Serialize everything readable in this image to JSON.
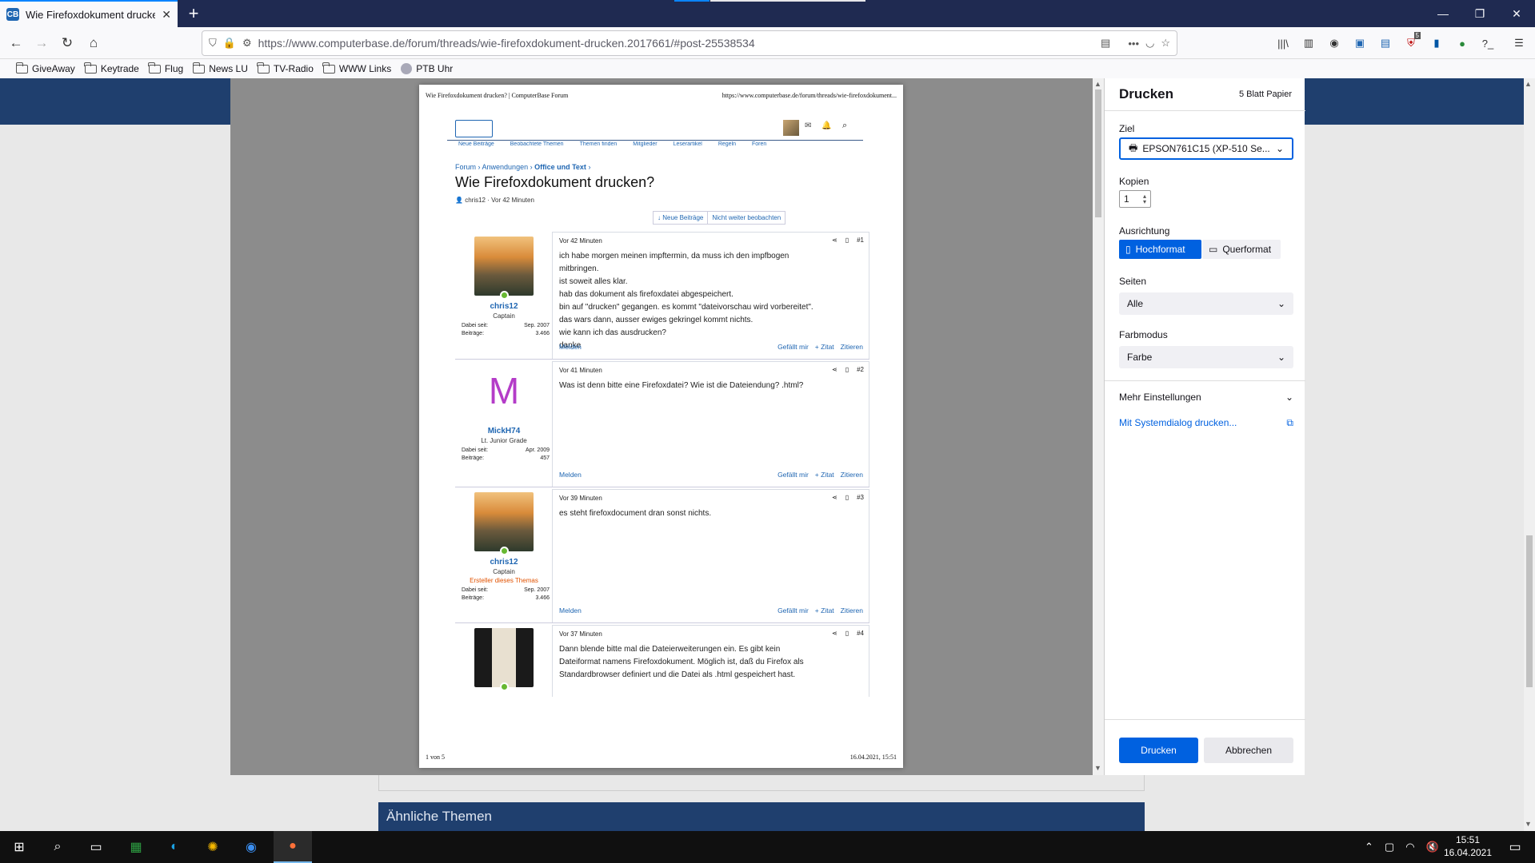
{
  "browser": {
    "tab_title": "Wie Firefoxdokument drucken?",
    "tab_icon": "CB",
    "new_tab": "+",
    "url": "https://www.computerbase.de/forum/threads/wie-firefoxdokument-drucken.2017661/#post-25538534",
    "bookmarks": [
      "GiveAway",
      "Keytrade",
      "Flug",
      "News LU",
      "TV-Radio",
      "WWW Links",
      "PTB Uhr"
    ],
    "toolbar_badge": "5"
  },
  "preview": {
    "header_left": "Wie Firefoxdokument drucken? | ComputerBase Forum",
    "header_right": "https://www.computerbase.de/forum/threads/wie-firefoxdokument...",
    "footer_left": "1 von 5",
    "footer_right": "16.04.2021, 15:51",
    "nav": [
      "Neue Beiträge",
      "Beobachtete Themen",
      "Themen finden",
      "Mitglieder",
      "Leserartikel",
      "Regeln",
      "Foren"
    ],
    "breadcrumb": [
      "Forum",
      "Anwendungen",
      "Office und Text"
    ],
    "thread_title": "Wie Firefoxdokument drucken?",
    "thread_meta": "chris12 · Vor 42 Minuten",
    "top_buttons": [
      "↓ Neue Beiträge",
      "Nicht weiter beobachten"
    ],
    "labels": {
      "joined": "Dabei seit:",
      "posts": "Beiträge:",
      "report": "Melden",
      "like": "Gefällt mir",
      "quote": "+ Zitat",
      "reply": "Zitieren"
    },
    "posts": [
      {
        "time": "Vor 42 Minuten",
        "num": "#1",
        "user": "chris12",
        "rank": "Captain",
        "creator": "",
        "joined": "Sep. 2007",
        "count": "3.466",
        "lines": [
          "ich habe morgen meinen impftermin, da muss ich den impfbogen",
          "mitbringen.",
          "ist soweit alles klar.",
          "hab das dokument als firefoxdatei abgespeichert.",
          "bin auf \"drucken\" gegangen. es kommt \"dateivorschau wird vorbereitet\".",
          "das wars dann, ausser ewiges gekringel kommt nichts.",
          "wie kann ich das ausdrucken?",
          "danke"
        ]
      },
      {
        "time": "Vor 41 Minuten",
        "num": "#2",
        "user": "MickH74",
        "rank": "Lt. Junior Grade",
        "creator": "",
        "joined": "Apr. 2009",
        "count": "457",
        "avatar_letter": "M",
        "lines": [
          "Was ist denn bitte eine Firefoxdatei? Wie ist die Dateiendung? .html?"
        ]
      },
      {
        "time": "Vor 39 Minuten",
        "num": "#3",
        "user": "chris12",
        "rank": "Captain",
        "creator": "Ersteller dieses Themas",
        "joined": "Sep. 2007",
        "count": "3.466",
        "lines": [
          "es steht firefoxdocument dran sonst nichts."
        ]
      },
      {
        "time": "Vor 37 Minuten",
        "num": "#4",
        "lines": [
          "Dann blende bitte mal die Dateierweiterungen ein. Es gibt kein",
          "Dateiformat namens Firefoxdokument. Möglich ist, daß du Firefox als",
          "Standardbrowser definiert und die Datei als .html gespeichert hast."
        ]
      }
    ]
  },
  "page_bottom": {
    "similar": "Ähnliche Themen"
  },
  "print": {
    "title": "Drucken",
    "sheets": "5 Blatt Papier",
    "dest_label": "Ziel",
    "dest_value": "EPSON761C15 (XP-510 Se...",
    "copies_label": "Kopien",
    "copies_value": "1",
    "orientation_label": "Ausrichtung",
    "portrait": "Hochformat",
    "landscape": "Querformat",
    "pages_label": "Seiten",
    "pages_value": "Alle",
    "color_label": "Farbmodus",
    "color_value": "Farbe",
    "more": "Mehr Einstellungen",
    "system_dialog": "Mit Systemdialog drucken...",
    "print_btn": "Drucken",
    "cancel_btn": "Abbrechen"
  },
  "taskbar": {
    "time": "15:51",
    "date": "16.04.2021"
  }
}
